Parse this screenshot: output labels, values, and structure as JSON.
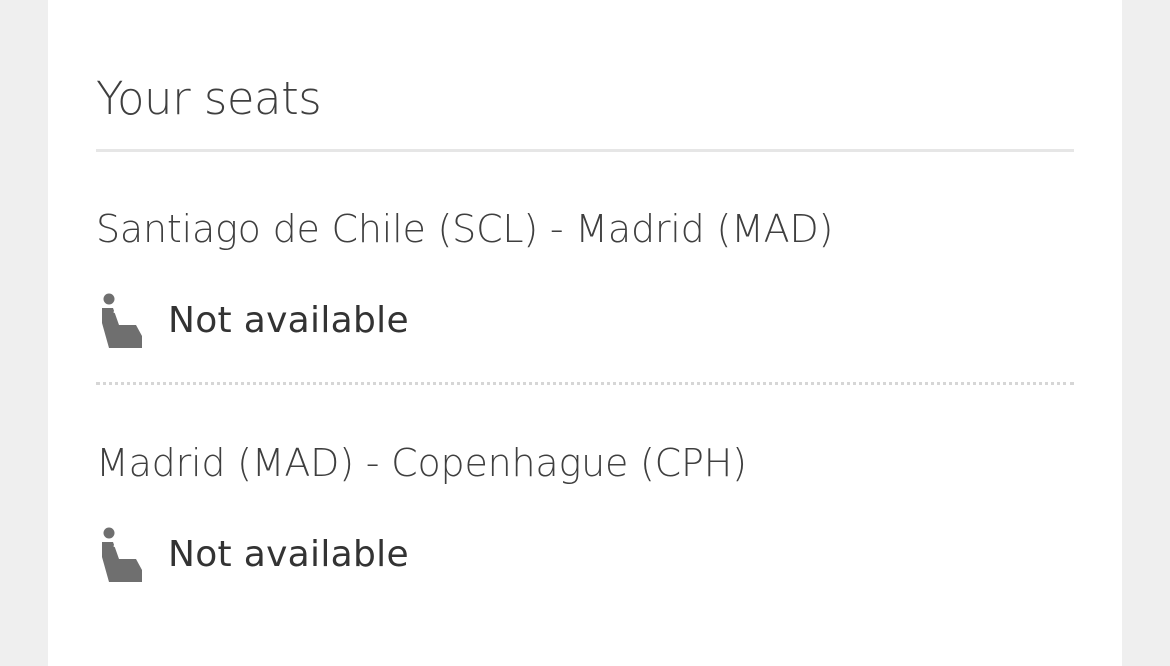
{
  "seats_section": {
    "title": "Your seats",
    "segments": [
      {
        "route": "Santiago de Chile (SCL) - Madrid (MAD)",
        "seat_status": "Not available",
        "icon": "seat-icon"
      },
      {
        "route": "Madrid (MAD) - Copenhague (CPH)",
        "seat_status": "Not available",
        "icon": "seat-icon"
      }
    ]
  },
  "colors": {
    "background": "#efefef",
    "card": "#ffffff",
    "text": "#3a3a3a",
    "icon": "#6f6f6f",
    "divider": "#e6e6e6"
  }
}
